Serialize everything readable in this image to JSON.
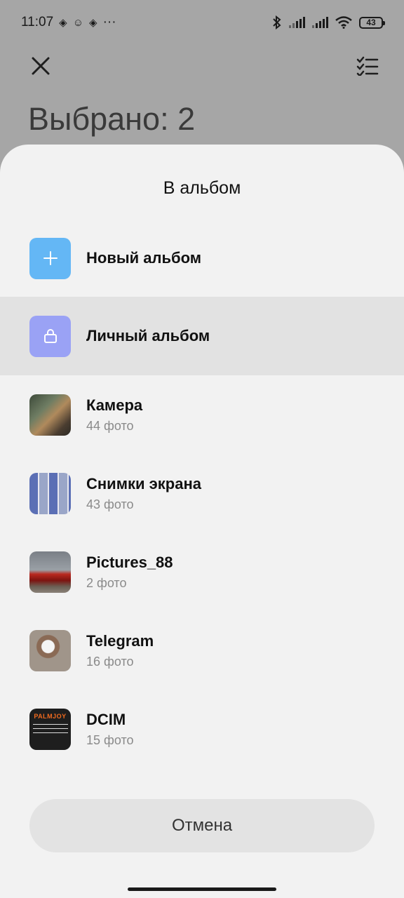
{
  "status_bar": {
    "time": "11:07",
    "notification_icons": [
      "binance-icon",
      "emoji-icon",
      "binance-icon"
    ],
    "more": "···",
    "battery": "43"
  },
  "header": {
    "title": "Выбрано: 2"
  },
  "sheet": {
    "title": "В альбом",
    "special_items": [
      {
        "label": "Новый альбом",
        "icon": "plus-icon",
        "color": "#64b7f5"
      },
      {
        "label": "Личный альбом",
        "icon": "lock-icon",
        "color": "#9aa2f5"
      }
    ],
    "albums": [
      {
        "name": "Камера",
        "count": "44 фото"
      },
      {
        "name": "Снимки экрана",
        "count": "43 фото"
      },
      {
        "name": "Pictures_88",
        "count": "2 фото"
      },
      {
        "name": "Telegram",
        "count": "16 фото"
      },
      {
        "name": "DCIM",
        "count": "15 фото"
      }
    ],
    "dcim_thumb_text": "PALMJOY",
    "cancel_label": "Отмена"
  }
}
